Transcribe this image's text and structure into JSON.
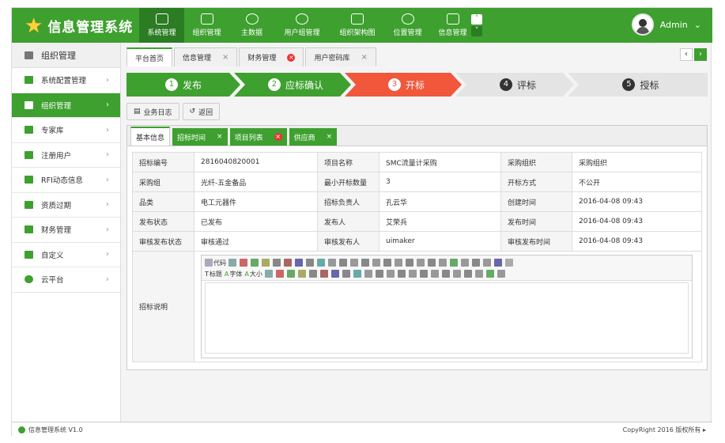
{
  "app": {
    "title": "信息管理系统"
  },
  "nav": [
    {
      "label": "系统管理"
    },
    {
      "label": "组织管理"
    },
    {
      "label": "主数据"
    },
    {
      "label": "用户组管理"
    },
    {
      "label": "组织架构图"
    },
    {
      "label": "位置管理"
    },
    {
      "label": "信息管理"
    }
  ],
  "user": {
    "name": "Admin"
  },
  "sidebar": {
    "header": "组织管理",
    "items": [
      {
        "label": "系统配置管理"
      },
      {
        "label": "组织管理"
      },
      {
        "label": "专家库"
      },
      {
        "label": "注册用户"
      },
      {
        "label": "RFI动态信息"
      },
      {
        "label": "资质过期"
      },
      {
        "label": "财务管理"
      },
      {
        "label": "自定义"
      },
      {
        "label": "云平台"
      }
    ]
  },
  "tabs": [
    {
      "label": "平台首页"
    },
    {
      "label": "信息管理"
    },
    {
      "label": "财务管理"
    },
    {
      "label": "用户密码库"
    }
  ],
  "steps": [
    {
      "num": "1",
      "label": "发布"
    },
    {
      "num": "2",
      "label": "应标确认"
    },
    {
      "num": "3",
      "label": "开标"
    },
    {
      "num": "4",
      "label": "评标"
    },
    {
      "num": "5",
      "label": "授标"
    }
  ],
  "toolbar": {
    "log_label": "业务日志",
    "back_label": "返回"
  },
  "subtabs": [
    {
      "label": "基本信息"
    },
    {
      "label": "招标时间"
    },
    {
      "label": "项目列表"
    },
    {
      "label": "供应商"
    }
  ],
  "table": [
    [
      "招标编号",
      "2816040820001",
      "项目名称",
      "SMC流量计采购",
      "采购组织",
      "采购组织"
    ],
    [
      "采购组",
      "光纤-五金备品",
      "最小开标数量",
      "3",
      "开标方式",
      "不公开"
    ],
    [
      "品类",
      "电工元器件",
      "招标负责人",
      "孔云华",
      "创建时间",
      "2016-04-08 09:43"
    ],
    [
      "发布状态",
      "已发布",
      "发布人",
      "艾荣兵",
      "发布时间",
      "2016-04-08 09:43"
    ],
    [
      "审核发布状态",
      "审核通过",
      "审核发布人",
      "uimaker",
      "审核发布时间",
      "2016-04-08 09:43"
    ]
  ],
  "desc_label": "招标说明",
  "editor": {
    "code": "代码",
    "heading": "标题",
    "font": "字体",
    "size": "大小"
  },
  "footer": {
    "left": "信息管理系统 V1.0",
    "right": "CopyRight 2016  版权所有 ▸"
  },
  "colors": {
    "brand": "#3ea02f",
    "active_step": "#f0573b"
  }
}
